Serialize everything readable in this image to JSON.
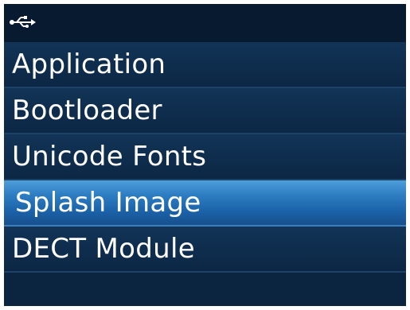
{
  "status_bar": {
    "icon": "usb-icon"
  },
  "menu": {
    "items": [
      {
        "label": "Application"
      },
      {
        "label": "Bootloader"
      },
      {
        "label": "Unicode Fonts"
      },
      {
        "label": "Splash Image"
      },
      {
        "label": "DECT Module"
      }
    ],
    "selected_label": "Splash Image"
  },
  "colors": {
    "background": "#0b2440",
    "status_bar": "#071a30",
    "selected": "#2f7fc4",
    "text": "#ffffff"
  }
}
